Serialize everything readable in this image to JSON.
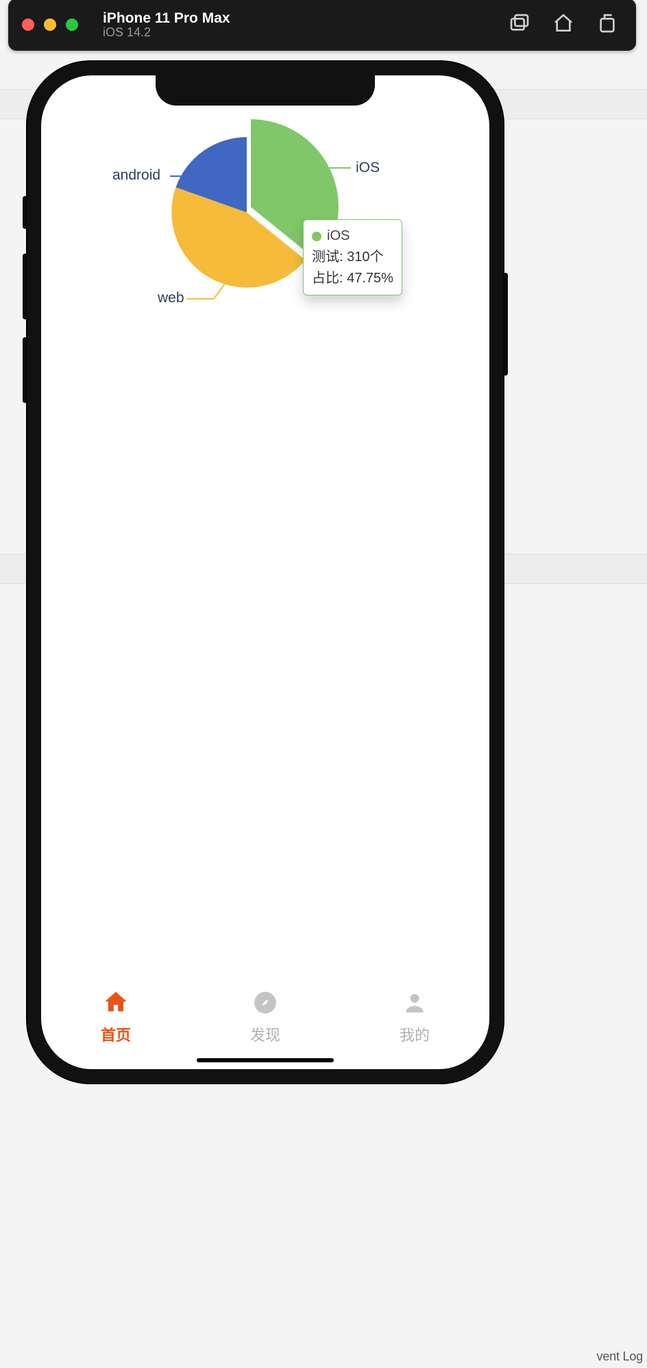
{
  "titlebar": {
    "device": "iPhone 11 Pro Max",
    "os": "iOS 14.2"
  },
  "chart_data": {
    "type": "pie",
    "series": [
      {
        "name": "iOS",
        "value": 310,
        "percent": 47.75,
        "color": "#80c769"
      },
      {
        "name": "web",
        "value": 225,
        "percent": 34.66,
        "color": "#f5bb39"
      },
      {
        "name": "android",
        "value": 114,
        "percent": 17.59,
        "color": "#4068c2"
      }
    ],
    "selected": "iOS",
    "value_unit": "个",
    "value_label": "测试",
    "percent_label": "占比"
  },
  "tooltip": {
    "title": "iOS",
    "line1": "测试: 310个",
    "line2": "占比: 47.75%"
  },
  "chart_labels": {
    "ios": "iOS",
    "web": "web",
    "android": "android"
  },
  "tabs": [
    {
      "id": "home",
      "label": "首页",
      "active": true
    },
    {
      "id": "discover",
      "label": "发现",
      "active": false
    },
    {
      "id": "me",
      "label": "我的",
      "active": false
    }
  ],
  "background_hint": "vent Log"
}
